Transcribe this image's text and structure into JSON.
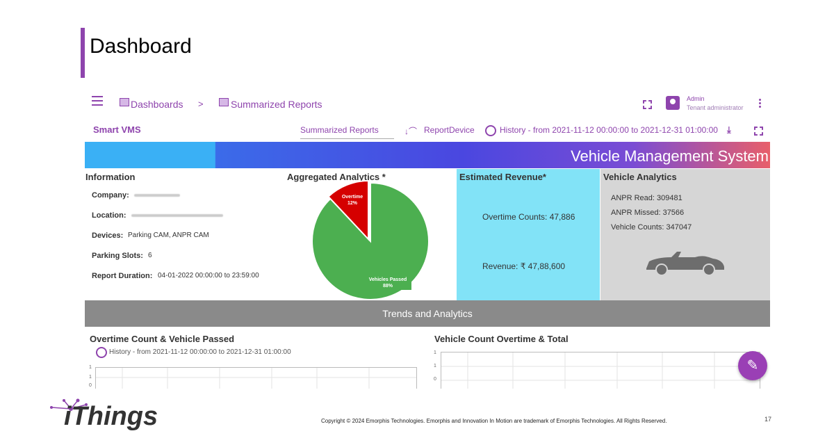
{
  "slide": {
    "title": "Dashboard",
    "page_number": "17"
  },
  "nav": {
    "breadcrumb_1": "Dashboards",
    "separator": ">",
    "breadcrumb_2": "Summarized Reports",
    "user_name": "Admin",
    "user_role": "Tenant administrator"
  },
  "toolbar": {
    "brand": "Smart VMS",
    "report_select": "Summarized Reports",
    "device_sort_icon": "↓⌒",
    "device_label": "ReportDevice",
    "history": "History - from 2021-11-12 00:00:00 to 2021-12-31 01:00:00",
    "download_icon": "⤓"
  },
  "banner": {
    "title": "Vehicle Management System"
  },
  "information": {
    "title": "Information",
    "company_label": "Company:",
    "location_label": "Location:",
    "devices_label": "Devices:",
    "devices_value": "Parking CAM, ANPR CAM",
    "parking_label": "Parking Slots:",
    "parking_value": "6",
    "duration_label": "Report Duration:",
    "duration_value": "04-01-2022 00:00:00 to 23:59:00"
  },
  "aggregated": {
    "title": "Aggregated Analytics *",
    "overtime_label": "Overtime",
    "overtime_pct": "12%",
    "passed_label": "Vehicles Passed",
    "passed_pct": "88%"
  },
  "revenue": {
    "title": "Estimated Revenue*",
    "overtime_counts": "Overtime Counts: 47,886",
    "revenue": "Revenue: ₹ 47,88,600"
  },
  "vehicle_analytics": {
    "title": "Vehicle Analytics",
    "anpr_read": "ANPR Read: 309481",
    "anpr_missed": "ANPR Missed: 37566",
    "vehicle_counts": "Vehicle Counts: 347047"
  },
  "trends": {
    "title": "Trends and Analytics"
  },
  "chart1": {
    "title": "Overtime Count & Vehicle Passed",
    "history": "History - from 2021-11-12 00:00:00 to 2021-12-31 01:00:00",
    "ticks": [
      "1",
      "1",
      "0"
    ]
  },
  "chart2": {
    "title": "Vehicle Count Overtime & Total",
    "ticks": [
      "1",
      "1",
      "0"
    ]
  },
  "fab": {
    "icon": "✎"
  },
  "footer": {
    "logo": "iThings",
    "copyright": "Copyright © 2024 Emorphis Technologies. Emorphis and Innovation In Motion are trademark of Emorphis Technologies. All Rights Reserved."
  },
  "colors": {
    "accent": "#8e44ad",
    "revenue_bg": "#82e3f7",
    "vehicle_bg": "#d6d6d6",
    "trends_bg": "#8a8a8a",
    "pie_green": "#4caf50",
    "pie_red": "#d50000"
  },
  "chart_data": {
    "type": "pie",
    "categories": [
      "Overtime",
      "Vehicles Passed"
    ],
    "values": [
      12,
      88
    ]
  }
}
